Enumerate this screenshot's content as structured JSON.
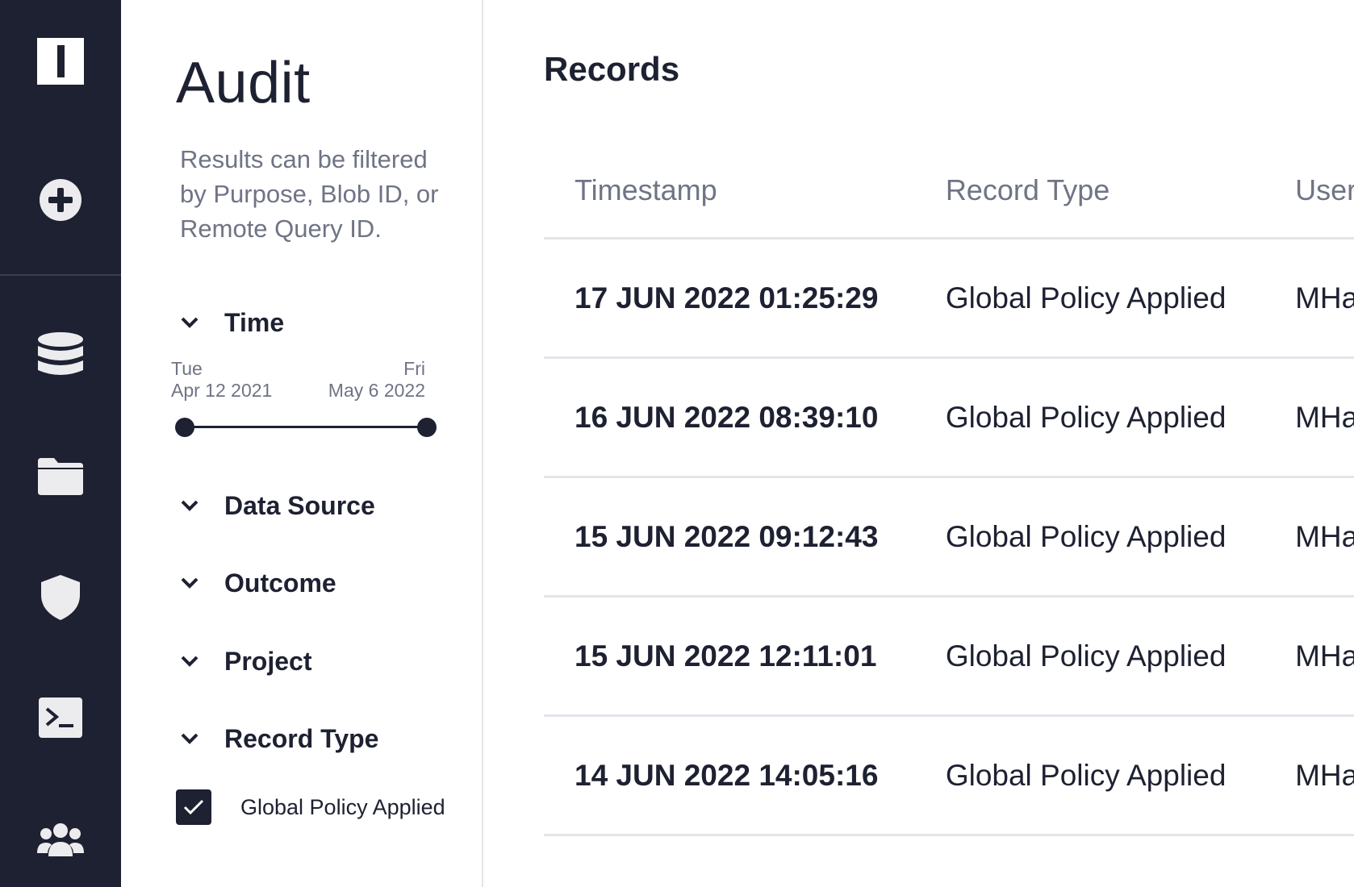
{
  "nav": {
    "logo_text": "I",
    "items": [
      {
        "icon": "add-icon"
      },
      {
        "icon": "database-icon"
      },
      {
        "icon": "folder-icon"
      },
      {
        "icon": "shield-icon"
      },
      {
        "icon": "terminal-icon"
      },
      {
        "icon": "users-icon"
      }
    ]
  },
  "filters": {
    "title": "Audit",
    "description": "Results can be filtered by Purpose, Blob ID, or Remote Query ID.",
    "time": {
      "label": "Time",
      "start_dow": "Tue",
      "start_date": "Apr 12 2021",
      "end_dow": "Fri",
      "end_date": "May 6 2022"
    },
    "sections": [
      "Data Source",
      "Outcome",
      "Project",
      "Record Type"
    ],
    "record_type_options": [
      {
        "label": "Global Policy Applied",
        "checked": true
      }
    ]
  },
  "records": {
    "title": "Records",
    "columns": [
      "Timestamp",
      "Record Type",
      "User"
    ],
    "rows": [
      {
        "timestamp": "17 JUN 2022 01:25:29",
        "type": "Global Policy Applied",
        "user": "MHar"
      },
      {
        "timestamp": "16 JUN 2022 08:39:10",
        "type": "Global Policy Applied",
        "user": "MHar"
      },
      {
        "timestamp": "15 JUN 2022 09:12:43",
        "type": "Global Policy Applied",
        "user": "MHar"
      },
      {
        "timestamp": "15 JUN 2022 12:11:01",
        "type": "Global Policy Applied",
        "user": "MHar"
      },
      {
        "timestamp": "14 JUN 2022 14:05:16",
        "type": "Global Policy Applied",
        "user": "MHar"
      }
    ]
  },
  "colors": {
    "nav_bg": "#1d2131",
    "icon": "#ececef",
    "text_primary": "#1d2131",
    "text_muted": "#6f7485",
    "divider": "#e3e5ea"
  }
}
